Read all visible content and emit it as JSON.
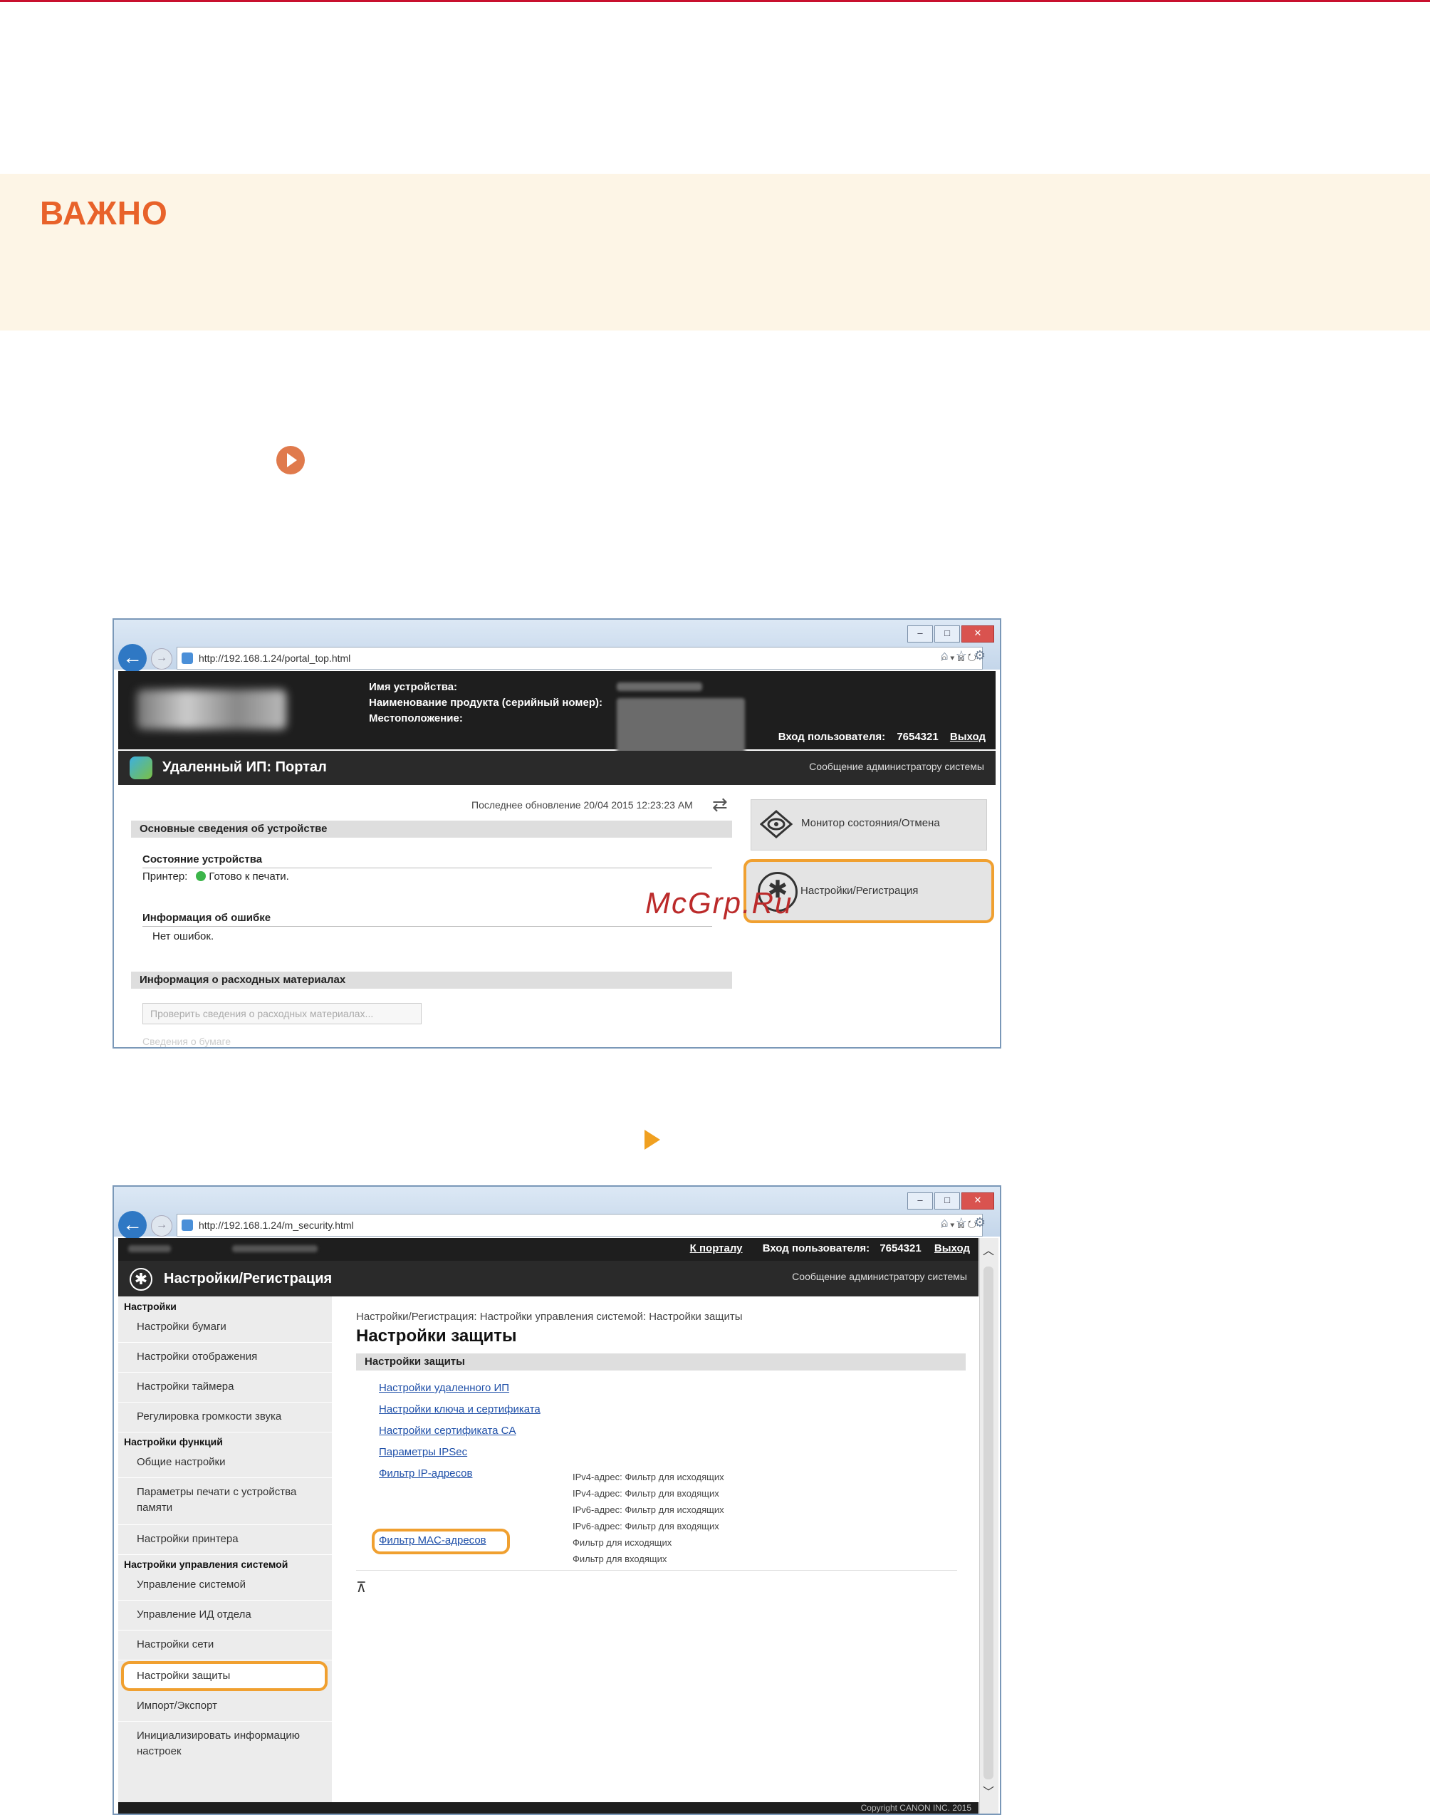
{
  "important": {
    "title": "ВАЖНО"
  },
  "watermark": "McGrp.Ru",
  "colors": {
    "accent": "#f0a030",
    "important_title": "#e8622a",
    "top_rule": "#c8102e"
  },
  "screenshot1": {
    "url": "http://192.168.1.24/portal_top.html",
    "device_labels": [
      "Имя устройства:",
      "Наименование продукта (серийный номер):",
      "Местоположение:"
    ],
    "login_label": "Вход пользователя:",
    "login_id": "7654321",
    "logout": "Выход",
    "portal_title": "Удаленный ИП: Портал",
    "admin_message": "Сообщение администратору системы",
    "last_updated": "Последнее обновление 20/04 2015 12:23:23 AM",
    "basic_info_header": "Основные сведения об устройстве",
    "device_status_label": "Состояние устройства",
    "printer_label": "Принтер:",
    "printer_status": "Готово к печати.",
    "error_info_label": "Информация об ошибке",
    "no_errors": "Нет ошибок.",
    "consumables_header": "Информация о расходных материалах",
    "check_consumables_button": "Проверить сведения о расходных материалах...",
    "paper_info_faded": "Сведения о бумаге",
    "status_monitor_button": "Монитор состояния/Отмена",
    "settings_button": "Настройки/Регистрация",
    "icons": [
      "refresh-icon",
      "eye-icon",
      "gear-icon"
    ]
  },
  "screenshot2": {
    "url": "http://192.168.1.24/m_security.html",
    "to_portal": "К порталу",
    "login_label": "Вход пользователя:",
    "login_id": "7654321",
    "logout": "Выход",
    "admin_message": "Сообщение администратору системы",
    "settings_title": "Настройки/Регистрация",
    "sidebar": {
      "sections": [
        {
          "title": "Настройки",
          "items": [
            "Настройки бумаги",
            "Настройки отображения",
            "Настройки таймера",
            "Регулировка громкости звука"
          ]
        },
        {
          "title": "Настройки функций",
          "items": [
            "Общие настройки",
            "Параметры печати с устройства памяти",
            "Настройки принтера"
          ]
        },
        {
          "title": "Настройки управления системой",
          "items": [
            "Управление системой",
            "Управление ИД отдела",
            "Настройки сети",
            "Настройки защиты",
            "Импорт/Экспорт",
            "Инициализировать информацию настроек"
          ]
        }
      ],
      "selected": "Настройки защиты"
    },
    "breadcrumb": "Настройки/Регистрация: Настройки управления системой: Настройки защиты",
    "page_title": "Настройки защиты",
    "section_header": "Настройки защиты",
    "links": [
      "Настройки удаленного ИП",
      "Настройки ключа и сертификата",
      "Настройки сертификата CA",
      "Параметры IPSec",
      "Фильтр IP-адресов",
      "Фильтр MAC-адресов"
    ],
    "ip_filter_notes": [
      "IPv4-адрес: Фильтр для исходящих",
      "IPv4-адрес: Фильтр для входящих",
      "IPv6-адрес: Фильтр для исходящих",
      "IPv6-адрес: Фильтр для входящих"
    ],
    "mac_filter_notes": [
      "Фильтр для исходящих",
      "Фильтр для входящих"
    ],
    "copyright": "Copyright CANON INC. 2015"
  }
}
